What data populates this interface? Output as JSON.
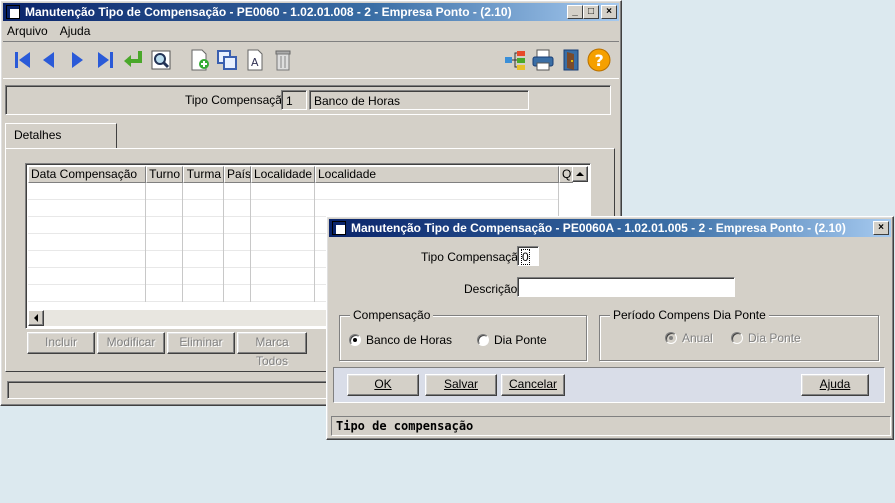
{
  "main": {
    "title": "Manutenção Tipo de Compensação - PE0060 - 1.02.01.008 - 2 - Empresa Ponto - (2.10)",
    "menu": [
      "Arquivo",
      "Ajuda"
    ],
    "tipo_label": "Tipo Compensação:",
    "tipo_code": "1",
    "tipo_desc": "Banco de Horas",
    "tab": "Detalhes",
    "columns": [
      "Data Compensação",
      "Turno",
      "Turma",
      "País",
      "Localidade",
      "Localidade",
      "Qt"
    ],
    "buttons": {
      "incluir": "Incluir",
      "modificar": "Modificar",
      "eliminar": "Eliminar",
      "marca_todos": "Marca Todos"
    },
    "window_controls": {
      "minimize": "_",
      "maximize": "□",
      "close": "×"
    }
  },
  "dialog": {
    "title": "Manutenção Tipo de Compensação - PE0060A - 1.02.01.005 - 2 - Empresa Ponto - (2.10)",
    "close": "×",
    "tipo_label": "Tipo Compensação:",
    "tipo_value": "0",
    "descricao_label": "Descrição:",
    "descricao_value": "",
    "compensacao": {
      "title": "Compensação",
      "options": [
        "Banco de Horas",
        "Dia Ponte"
      ],
      "selected": "Banco de Horas"
    },
    "periodo": {
      "title": "Período Compens Dia Ponte",
      "options": [
        "Anual",
        "Dia Ponte"
      ],
      "selected": "Anual"
    },
    "buttons": {
      "ok": "OK",
      "salvar": "Salvar",
      "cancelar": "Cancelar",
      "ajuda": "Ajuda"
    },
    "status": "Tipo de compensação"
  }
}
